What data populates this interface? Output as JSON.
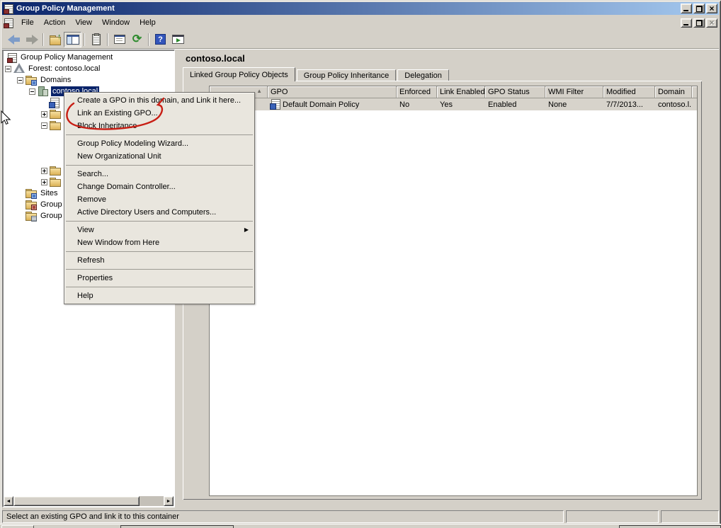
{
  "window": {
    "title": "Group Policy Management"
  },
  "menubar": {
    "items": [
      "File",
      "Action",
      "View",
      "Window",
      "Help"
    ]
  },
  "toolbar": {
    "buttons": [
      "back",
      "forward",
      "up-one-level",
      "show-console-tree",
      "export-list",
      "properties",
      "refresh",
      "help",
      "show-in-new-window"
    ]
  },
  "tree": {
    "items": [
      {
        "label": "Group Policy Management",
        "icon": "console-icon"
      },
      {
        "label": "Forest: contoso.local",
        "icon": "forest-icon"
      },
      {
        "label": "Domains",
        "icon": "domains-folder-icon"
      },
      {
        "label": "contoso.local",
        "icon": "domain-icon",
        "selected": true
      },
      {
        "label": "",
        "icon": "gpo-icon"
      },
      {
        "label": "",
        "icon": "folder-icon"
      },
      {
        "label": "",
        "icon": "folder-icon"
      },
      {
        "label": ""
      },
      {
        "label": ""
      },
      {
        "label": ""
      },
      {
        "label": "",
        "icon": "folder-icon"
      },
      {
        "label": "",
        "icon": "folder-icon"
      },
      {
        "label": "Sites",
        "icon": "sites-folder-icon"
      },
      {
        "label": "Group Policy Modeling",
        "icon": "modeling-icon"
      },
      {
        "label": "Group Policy Results",
        "icon": "results-folder-icon"
      }
    ]
  },
  "context_menu": {
    "items": [
      {
        "label": "Create a GPO in this domain, and Link it here..."
      },
      {
        "label": "Link an Existing GPO...",
        "annotated": true
      },
      {
        "label": "Block Inheritance"
      },
      {
        "label": "Group Policy Modeling Wizard..."
      },
      {
        "label": "New Organizational Unit"
      },
      {
        "label": "Search..."
      },
      {
        "label": "Change Domain Controller..."
      },
      {
        "label": "Remove"
      },
      {
        "label": "Active Directory Users and Computers..."
      },
      {
        "label": "View",
        "has_submenu": true
      },
      {
        "label": "New Window from Here"
      },
      {
        "label": "Refresh"
      },
      {
        "label": "Properties"
      },
      {
        "label": "Help"
      }
    ]
  },
  "content": {
    "title": "contoso.local",
    "tabs": [
      "Linked Group Policy Objects",
      "Group Policy Inheritance",
      "Delegation"
    ],
    "active_tab": "Linked Group Policy Objects",
    "table": {
      "columns": [
        "",
        "GPO",
        "Enforced",
        "Link Enabled",
        "GPO Status",
        "WMI Filter",
        "Modified",
        "Domain"
      ],
      "rows": [
        {
          "gpo": "Default Domain Policy",
          "enforced": "No",
          "link_enabled": "Yes",
          "gpo_status": "Enabled",
          "wmi_filter": "None",
          "modified": "7/7/2013...",
          "domain": "contoso.l..."
        }
      ]
    }
  },
  "status_bar": {
    "text": "Select an existing GPO and link it to this container"
  },
  "colors": {
    "titlebar_start": "#0a246a",
    "titlebar_end": "#a6caf0",
    "face": "#d4d0c8",
    "selection": "#0a246a",
    "menu_bg": "#e9e6de",
    "row_selected": "#d7d3cb",
    "annotation": "#c81e14"
  }
}
